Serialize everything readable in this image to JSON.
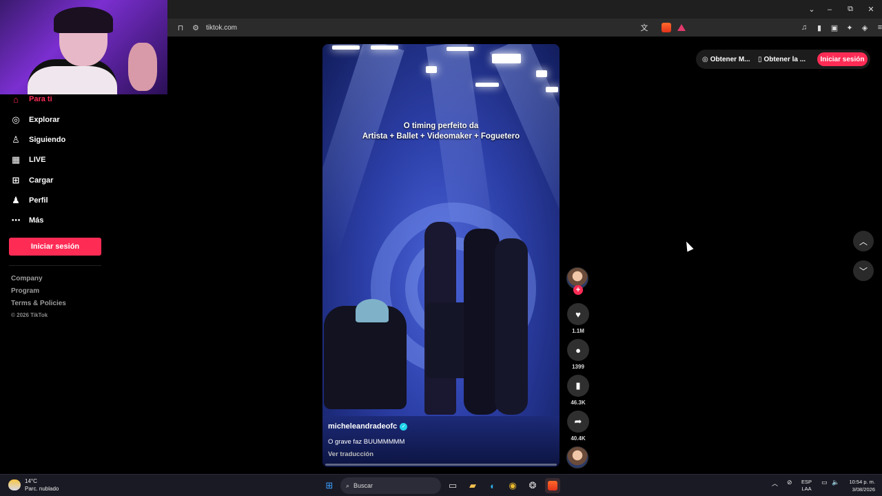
{
  "browser": {
    "url": "tiktok.com",
    "window_controls": {
      "dropdown": "⌄",
      "minimize": "–",
      "restore": "⧉",
      "close": "✕"
    }
  },
  "sidebar": {
    "items": [
      {
        "label": "Para ti",
        "icon": "home-icon"
      },
      {
        "label": "Explorar",
        "icon": "compass-icon"
      },
      {
        "label": "Siguiendo",
        "icon": "user-follow-icon"
      },
      {
        "label": "LIVE",
        "icon": "live-icon"
      },
      {
        "label": "Cargar",
        "icon": "upload-icon"
      },
      {
        "label": "Perfil",
        "icon": "profile-icon"
      },
      {
        "label": "Más",
        "icon": "more-icon"
      }
    ],
    "login_label": "Iniciar sesión",
    "footer": {
      "links": [
        "Company",
        "Program",
        "Terms & Policies"
      ],
      "copyright": "© 2026 TikTok"
    }
  },
  "video": {
    "overlay_line1": "O timing perfeito da",
    "overlay_line2": "Artista + Ballet + Videomaker + Foguetero",
    "author": "micheleandradeofc",
    "caption": "O grave faz BUUMMMMM",
    "translate_label": "Ver traducción",
    "progress": 0.02
  },
  "actions": {
    "likes": "1.1M",
    "comments": "1399",
    "saves": "46.3K",
    "shares": "40.4K"
  },
  "top": {
    "get_app_1": "Obtener M...",
    "get_app_2": "Obtener la ...",
    "login_label": "Iniciar sesión"
  },
  "taskbar": {
    "temperature": "14°C",
    "weather": "Parc. nublado",
    "search_placeholder": "Buscar",
    "lang_1": "ESP",
    "lang_2": "LAA",
    "time": "10:54 p. m.",
    "date": "3/08/2026"
  },
  "colors": {
    "accent": "#fe2c55",
    "background": "#000000",
    "verified": "#20d5ec"
  }
}
